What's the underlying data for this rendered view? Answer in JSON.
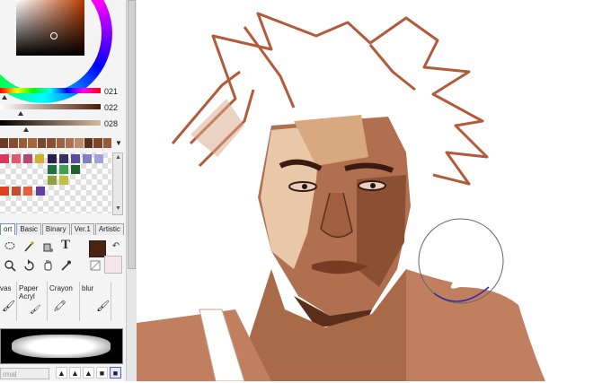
{
  "color_panel": {
    "sliders": [
      {
        "value": "021"
      },
      {
        "value": "022"
      },
      {
        "value": "028"
      }
    ],
    "main_color": "#4a2410",
    "sub_color": "#f6e6ea",
    "swatches": [
      "#6b3a28",
      "#8a4a30",
      "#9b5a3a",
      "#a5653f",
      "#7a4a30",
      "#8b5030",
      "#a06040",
      "#b07050",
      "#c08a68",
      "#5a3020",
      "#7e4528",
      "#9a5a38"
    ]
  },
  "palette_colors": [
    "#d83a5a",
    "#e05a6a",
    "#b04a70",
    "#d0b030",
    "#282048",
    "#3a3060",
    "#5a4a9a",
    "#8080c0",
    "#a0a0e0",
    "#207040",
    "#40a050",
    "#206030",
    "#90a040",
    "#c0c040",
    "#e04020",
    "#c05030",
    "#e06040",
    "#604098"
  ],
  "tool_tabs": [
    "ort",
    "Basic",
    "Binary",
    "Ver.1",
    "Artistic"
  ],
  "tools": {
    "row1": [
      "lasso-icon",
      "magic-wand-icon",
      "bucket-icon",
      "text-icon"
    ],
    "row2": [
      "magnifier-icon",
      "rotate-icon",
      "hand-icon",
      "eyedropper-icon"
    ],
    "text_tool_label": "T"
  },
  "brushes": [
    {
      "label": "vas"
    },
    {
      "label": "Paper Acryl"
    },
    {
      "label": "Crayon"
    },
    {
      "label": "blur"
    }
  ],
  "blend_mode": "rmal",
  "brush_shapes": [
    "▲",
    "▲",
    "▲",
    "■",
    "■"
  ]
}
